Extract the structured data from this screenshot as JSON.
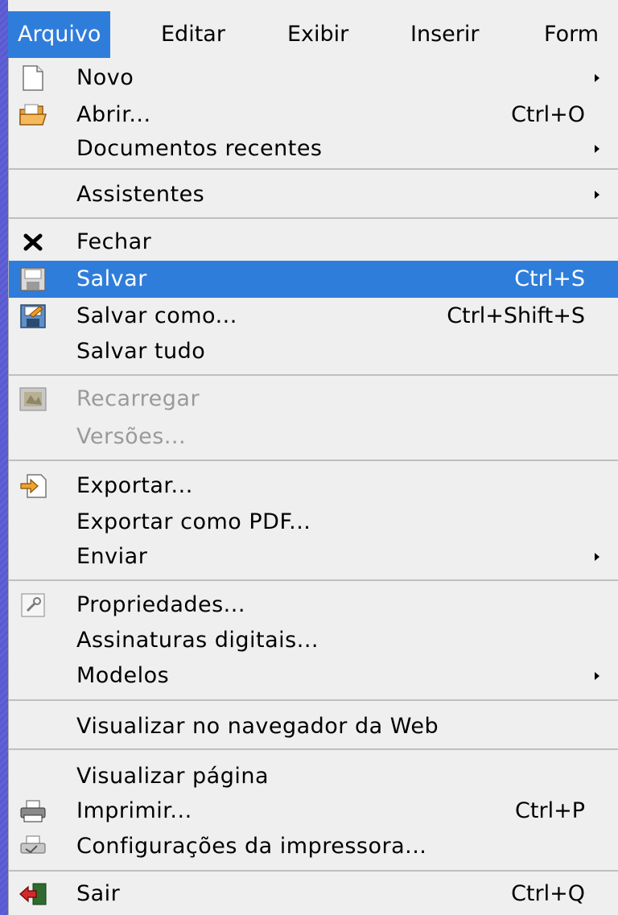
{
  "menubar": {
    "items": [
      {
        "label": "Arquivo"
      },
      {
        "label": "Editar"
      },
      {
        "label": "Exibir"
      },
      {
        "label": "Inserir"
      },
      {
        "label": "Form"
      }
    ]
  },
  "menu": {
    "items": [
      {
        "label": "Novo",
        "icon": "new-document-icon",
        "submenu": true
      },
      {
        "label": "Abrir...",
        "shortcut": "Ctrl+O",
        "icon": "open-folder-icon"
      },
      {
        "label": "Documentos recentes",
        "submenu": true
      },
      {
        "label": "Assistentes",
        "submenu": true
      },
      {
        "label": "Fechar",
        "icon": "close-icon"
      },
      {
        "label": "Salvar",
        "shortcut": "Ctrl+S",
        "icon": "save-icon",
        "selected": true
      },
      {
        "label": "Salvar como...",
        "shortcut": "Ctrl+Shift+S",
        "icon": "save-as-icon"
      },
      {
        "label": "Salvar tudo"
      },
      {
        "label": "Recarregar",
        "icon": "reload-icon",
        "disabled": true
      },
      {
        "label": "Versões...",
        "disabled": true
      },
      {
        "label": "Exportar...",
        "icon": "export-icon"
      },
      {
        "label": "Exportar como PDF..."
      },
      {
        "label": "Enviar",
        "submenu": true
      },
      {
        "label": "Propriedades...",
        "icon": "properties-icon"
      },
      {
        "label": "Assinaturas digitais..."
      },
      {
        "label": "Modelos",
        "submenu": true
      },
      {
        "label": "Visualizar no navegador da Web"
      },
      {
        "label": "Visualizar página"
      },
      {
        "label": "Imprimir...",
        "shortcut": "Ctrl+P",
        "icon": "printer-icon"
      },
      {
        "label": "Configurações da impressora...",
        "icon": "printer-settings-icon"
      },
      {
        "label": "Sair",
        "shortcut": "Ctrl+Q",
        "icon": "exit-icon"
      }
    ]
  },
  "colors": {
    "highlight": "#2f7ddb",
    "menu_bg": "#efefef",
    "disabled_text": "#9a9a9a",
    "desktop": "#5a5ad2"
  }
}
